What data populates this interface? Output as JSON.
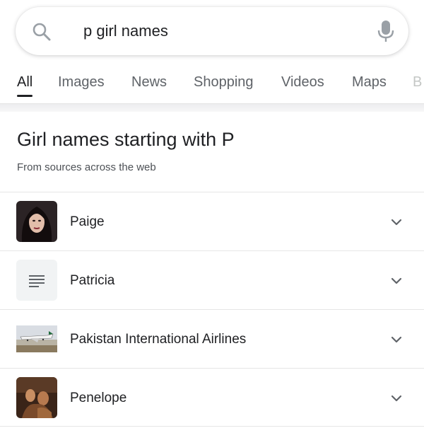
{
  "search": {
    "query": "p girl names"
  },
  "tabs": [
    {
      "label": "All",
      "active": true
    },
    {
      "label": "Images",
      "active": false
    },
    {
      "label": "News",
      "active": false
    },
    {
      "label": "Shopping",
      "active": false
    },
    {
      "label": "Videos",
      "active": false
    },
    {
      "label": "Maps",
      "active": false
    },
    {
      "label": "B",
      "active": false
    }
  ],
  "card": {
    "title": "Girl names starting with P",
    "subtitle": "From sources across the web",
    "items": [
      {
        "label": "Paige",
        "thumbnail": "portrait-photo"
      },
      {
        "label": "Patricia",
        "thumbnail": "text-lines-icon"
      },
      {
        "label": "Pakistan International Airlines",
        "thumbnail": "airplane-photo"
      },
      {
        "label": "Penelope",
        "thumbnail": "painting-photo"
      }
    ]
  },
  "colors": {
    "text_primary": "#202124",
    "text_secondary": "#5f6368",
    "divider": "#e6e6e6"
  }
}
